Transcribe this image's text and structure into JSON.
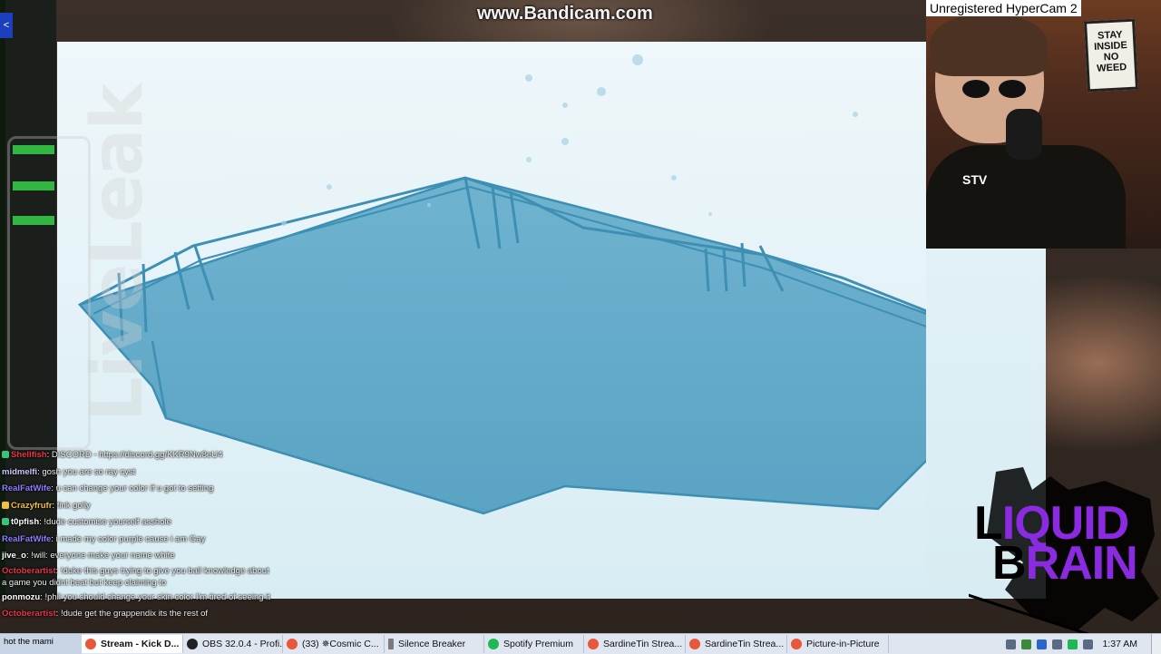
{
  "watermark": "www.Bandicam.com",
  "hypercam_label": "Unregistered HyperCam 2",
  "liveleak_text": "LiveLeak",
  "webcam": {
    "poster_text": "STAY INSIDE NO WEED",
    "shirt_text": "STV"
  },
  "chat": [
    {
      "user": "Shellfish",
      "color": "#e8344a",
      "text": "DISCORD - https://discord.gg/KKR9Nw8eU4"
    },
    {
      "user": "midmelfi",
      "color": "#c9c9ff",
      "text": "gosh you are so ray cyst"
    },
    {
      "user": "RealFatWife",
      "color": "#8f7cff",
      "text": "u can change your color if u got to setting"
    },
    {
      "user": "Crazyfrufr",
      "color": "#f0c040",
      "text": "fink golly"
    },
    {
      "user": "t0pfish",
      "color": "#ffffff",
      "text": "!dude customise yourself asshole"
    },
    {
      "user": "RealFatWife",
      "color": "#8f7cff",
      "text": "i made my color purple cause i am Gay"
    },
    {
      "user": "jive_o",
      "color": "#ffffff",
      "text": "!will: everyone make your name white"
    },
    {
      "user": "Octoberartist",
      "color": "#e8344a",
      "text": "!duke this guys trying to give you ball knowledge about a game you didnt beat but keep claiming to"
    },
    {
      "user": "ponmozu",
      "color": "#ffffff",
      "text": "!phil you should change your skin color I'm tired of seeing it"
    },
    {
      "user": "Octoberartist",
      "color": "#e8344a",
      "text": "!dude get the grappendix its the rest of"
    }
  ],
  "logo": {
    "line1_black": "L",
    "line1_purple": "IQUID",
    "line2_black": "B",
    "line2_purple": "RAIN"
  },
  "taskbar": {
    "start_label": "hot the mami",
    "items": [
      {
        "label": "Stream - Kick D...",
        "icon_color": "#e8573a",
        "active": true
      },
      {
        "label": "OBS 32.0.4 - Profi...",
        "icon_color": "#222222",
        "active": false
      },
      {
        "label": "(33) ✵Cosmic C...",
        "icon_color": "#e8573a",
        "active": false
      },
      {
        "label": "Silence Breaker",
        "icon_color": "#7a7a7a",
        "active": false
      },
      {
        "label": "Spotify Premium",
        "icon_color": "#1db954",
        "active": false
      },
      {
        "label": "SardineTin Strea...",
        "icon_color": "#e8573a",
        "active": false
      },
      {
        "label": "SardineTin Strea...",
        "icon_color": "#e8573a",
        "active": false
      },
      {
        "label": "Picture-in-Picture",
        "icon_color": "#e8573a",
        "active": false
      }
    ],
    "clock": "1:37 AM"
  },
  "colors": {
    "water": "#6fb3cf",
    "water_dark": "#3e8fb4",
    "logo_purple": "#8a2be2"
  }
}
